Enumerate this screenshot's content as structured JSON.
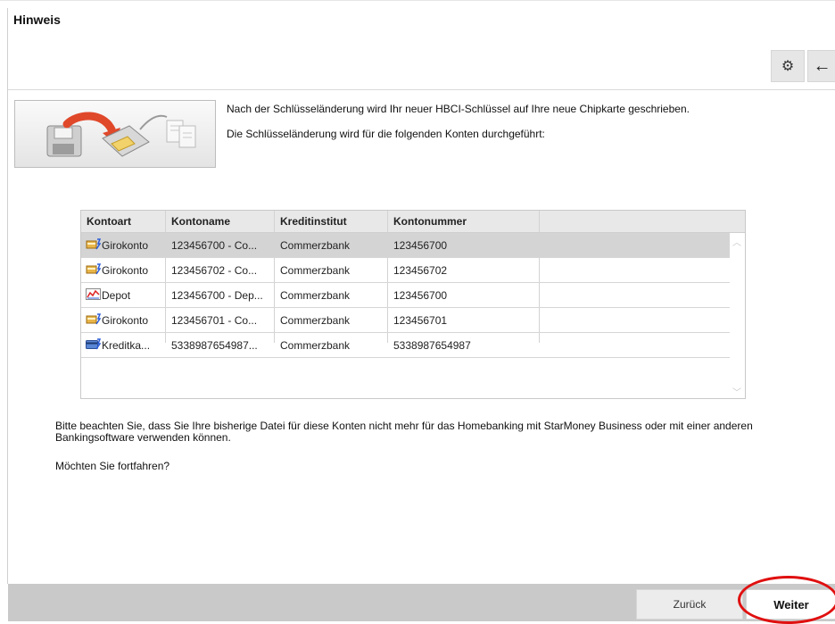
{
  "dialog": {
    "title": "Hinweis"
  },
  "toolbar": {
    "settings_icon": "gears-icon",
    "back_icon": "arrow-left-icon"
  },
  "intro": {
    "line1": "Nach der Schlüsseländerung wird Ihr neuer HBCI-Schlüssel auf Ihre neue Chipkarte geschrieben.",
    "line2": "Die Schlüsseländerung wird für die folgenden Konten durchgeführt:"
  },
  "table": {
    "columns": [
      "Kontoart",
      "Kontoname",
      "Kreditinstitut",
      "Kontonummer"
    ],
    "rows": [
      {
        "icon": "giro-account-icon",
        "kontoart": "Girokonto",
        "kontoname": "123456700 - Co...",
        "kreditinstitut": "Commerzbank",
        "kontonummer": "123456700",
        "selected": true
      },
      {
        "icon": "giro-account-icon",
        "kontoart": "Girokonto",
        "kontoname": "123456702 - Co...",
        "kreditinstitut": "Commerzbank",
        "kontonummer": "123456702",
        "selected": false
      },
      {
        "icon": "depot-chart-icon",
        "kontoart": "Depot",
        "kontoname": "123456700 - Dep...",
        "kreditinstitut": "Commerzbank",
        "kontonummer": "123456700",
        "selected": false
      },
      {
        "icon": "giro-account-icon",
        "kontoart": "Girokonto",
        "kontoname": "123456701 - Co...",
        "kreditinstitut": "Commerzbank",
        "kontonummer": "123456701",
        "selected": false
      },
      {
        "icon": "credit-card-icon",
        "kontoart": "Kreditka...",
        "kontoname": "5338987654987...",
        "kreditinstitut": "Commerzbank",
        "kontonummer": "5338987654987",
        "selected": false
      }
    ]
  },
  "note": "Bitte beachten Sie, dass Sie Ihre bisherige Datei für diese Konten nicht mehr für das Homebanking mit StarMoney Business oder mit einer anderen Bankingsoftware verwenden können.",
  "question": "Möchten Sie fortfahren?",
  "buttons": {
    "back": "Zurück",
    "next": "Weiter"
  },
  "colors": {
    "footer": "#c9c9c9",
    "selected_row": "#d4d4d4",
    "highlight": "#e01010"
  }
}
